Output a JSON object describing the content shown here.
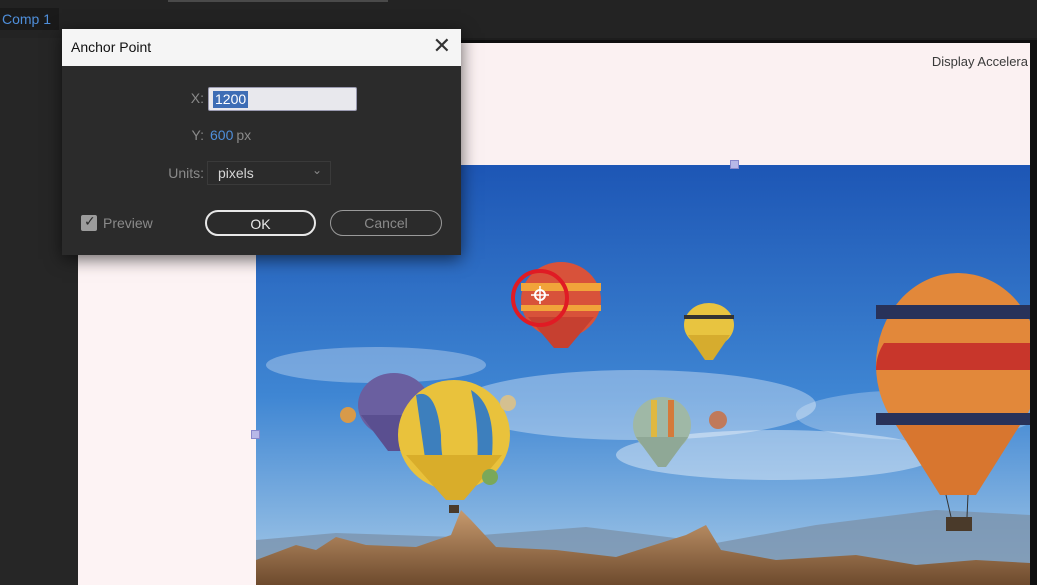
{
  "panel": {
    "tab_label": "Comp 1"
  },
  "viewer": {
    "display_label": "Display Accelera"
  },
  "dialog": {
    "title": "Anchor Point",
    "close_glyph": "✕",
    "x_label": "X:",
    "x_value": "1200",
    "y_label": "Y:",
    "y_value": "600",
    "y_unit": "px",
    "units_label": "Units:",
    "units_value": "pixels",
    "preview_label": "Preview",
    "preview_checked": true,
    "ok_label": "OK",
    "cancel_label": "Cancel"
  },
  "icons": {
    "close": "close-icon",
    "chevron": "chevron-down-icon",
    "checkbox": "checkbox-checked-icon",
    "anchor": "anchor-point-icon"
  },
  "colors": {
    "accent_blue": "#4f8fdb",
    "selection_blue": "#3d6db5",
    "panel_bg": "#2b2b2b",
    "highlight_circle": "#e01b24"
  }
}
